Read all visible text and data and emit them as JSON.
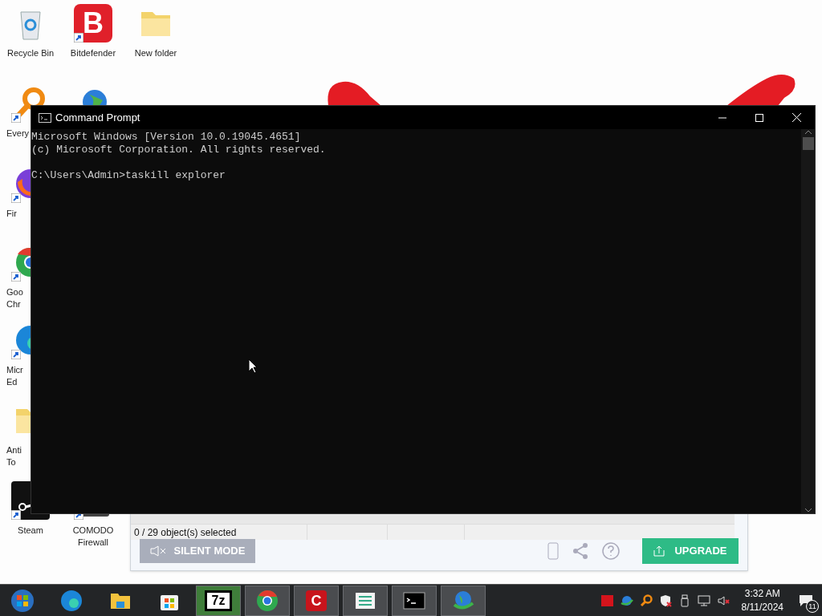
{
  "desktop_icons": [
    {
      "kind": "recycle",
      "shortcut": false,
      "label": [
        "Recycle Bin"
      ]
    },
    {
      "kind": "letter_logo",
      "glyph": "B",
      "shortcut": true,
      "label": [
        "Bitdefender"
      ]
    },
    {
      "kind": "folder",
      "shortcut": false,
      "label": [
        "New folder"
      ]
    },
    {
      "kind": "magnifier",
      "shortcut": true,
      "label": [
        "Every"
      ]
    },
    {
      "kind": "globe"
    },
    {
      "kind": "firefox",
      "shortcut": true,
      "label": [
        "Fir"
      ]
    },
    {
      "kind": "chrome",
      "shortcut": true,
      "label": [
        "Goo",
        "Chr"
      ]
    },
    {
      "kind": "edge",
      "shortcut": true,
      "label": [
        "Micr",
        "Ed"
      ]
    },
    {
      "kind": "folder",
      "shortcut": false,
      "label": [
        "Anti",
        "To"
      ]
    },
    {
      "kind": "steam",
      "shortcut": true,
      "label": [
        "Steam"
      ]
    },
    {
      "kind": "dark_app",
      "shortcut": true,
      "label": [
        "COMODO",
        "Firewall"
      ]
    }
  ],
  "background_window": {
    "status": "0 / 29 object(s) selected",
    "silent_button": "SILENT MODE",
    "upgrade_button": "UPGRADE"
  },
  "console": {
    "title": "Command Prompt",
    "output": [
      "Microsoft Windows [Version 10.0.19045.4651]",
      "(c) Microsoft Corporation. All rights reserved."
    ],
    "prompt": "C:\\Users\\Admin>",
    "command": "taskill explorer"
  },
  "taskbar": {
    "apps": [
      {
        "kind": "start",
        "running": false,
        "selected": false
      },
      {
        "kind": "edge",
        "running": false,
        "selected": false
      },
      {
        "kind": "explorer",
        "running": false,
        "selected": false
      },
      {
        "kind": "store",
        "running": false,
        "selected": false
      },
      {
        "kind": "letter_logo",
        "glyph": "7z",
        "running": true,
        "selected": true
      },
      {
        "kind": "chrome",
        "running": true,
        "selected": false
      },
      {
        "kind": "red_logo",
        "glyph": "C",
        "running": true,
        "selected": false
      },
      {
        "kind": "list",
        "running": true,
        "selected": false
      },
      {
        "kind": "console",
        "running": true,
        "selected": false
      },
      {
        "kind": "globe",
        "running": true,
        "selected": false
      }
    ],
    "tray": [
      {
        "kind": "red_badge"
      },
      {
        "kind": "globe"
      },
      {
        "kind": "magnifier"
      },
      {
        "kind": "shield"
      },
      {
        "kind": "usb"
      },
      {
        "kind": "network"
      },
      {
        "kind": "speaker_muted"
      }
    ],
    "time": "3:32 AM",
    "date": "8/11/2024",
    "notifications": "11"
  }
}
